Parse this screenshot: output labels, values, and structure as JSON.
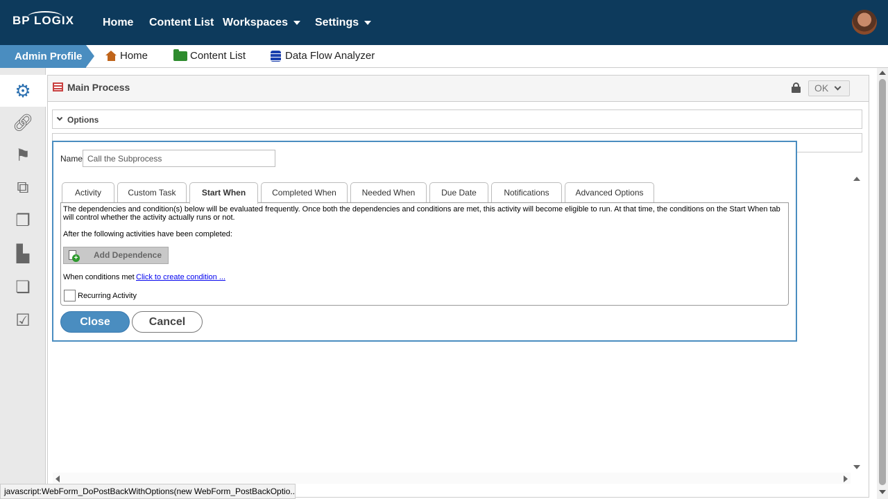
{
  "brand": {
    "logo": "BP LOGIX"
  },
  "topnav": {
    "items": [
      {
        "label": "Home"
      },
      {
        "label": "Content List"
      },
      {
        "label": "Workspaces"
      },
      {
        "label": "Settings"
      }
    ]
  },
  "breadcrumb": {
    "admin": "Admin Profile",
    "items": [
      {
        "label": "Home",
        "icon": "home-icon"
      },
      {
        "label": "Content List",
        "icon": "folder-icon"
      },
      {
        "label": "Data Flow Analyzer",
        "icon": "database-icon"
      }
    ]
  },
  "sidebar": {
    "items": [
      {
        "icon": "gears-icon",
        "active": true
      },
      {
        "icon": "link-icon"
      },
      {
        "icon": "flag-icon"
      },
      {
        "icon": "subprocess-icon"
      },
      {
        "icon": "copy-blocks-icon"
      },
      {
        "icon": "locked-document-icon"
      },
      {
        "icon": "stacked-pages-icon"
      },
      {
        "icon": "checklist-icon"
      }
    ]
  },
  "process": {
    "title": "Main Process",
    "ok_label": "OK"
  },
  "options": {
    "label": "Options"
  },
  "dialog": {
    "name_label": "Name",
    "name_value": "Call the Subprocess",
    "tabs": [
      {
        "label": "Activity"
      },
      {
        "label": "Custom Task"
      },
      {
        "label": "Start When",
        "active": true
      },
      {
        "label": "Completed When"
      },
      {
        "label": "Needed When"
      },
      {
        "label": "Due Date"
      },
      {
        "label": "Notifications"
      },
      {
        "label": "Advanced Options"
      }
    ],
    "start_when": {
      "description": "The dependencies and condition(s) below will be evaluated frequently. Once both the dependencies and conditions are met, this activity will become eligible to run. At that time, the conditions on the Start When tab will control whether the activity actually runs or not.",
      "after_text": "After the following activities have been completed:",
      "add_dependence": "Add Dependence",
      "when_conditions": "When conditions met",
      "condition_link": "Click to create condition ...",
      "recurring_label": "Recurring Activity"
    },
    "close_label": "Close",
    "cancel_label": "Cancel"
  },
  "statusbar": {
    "text": "javascript:WebForm_DoPostBackWithOptions(new WebForm_PostBackOptio..."
  },
  "colors": {
    "nav_bg": "#0d3a5c",
    "accent": "#4a8dc0",
    "link": "#0000ee"
  }
}
